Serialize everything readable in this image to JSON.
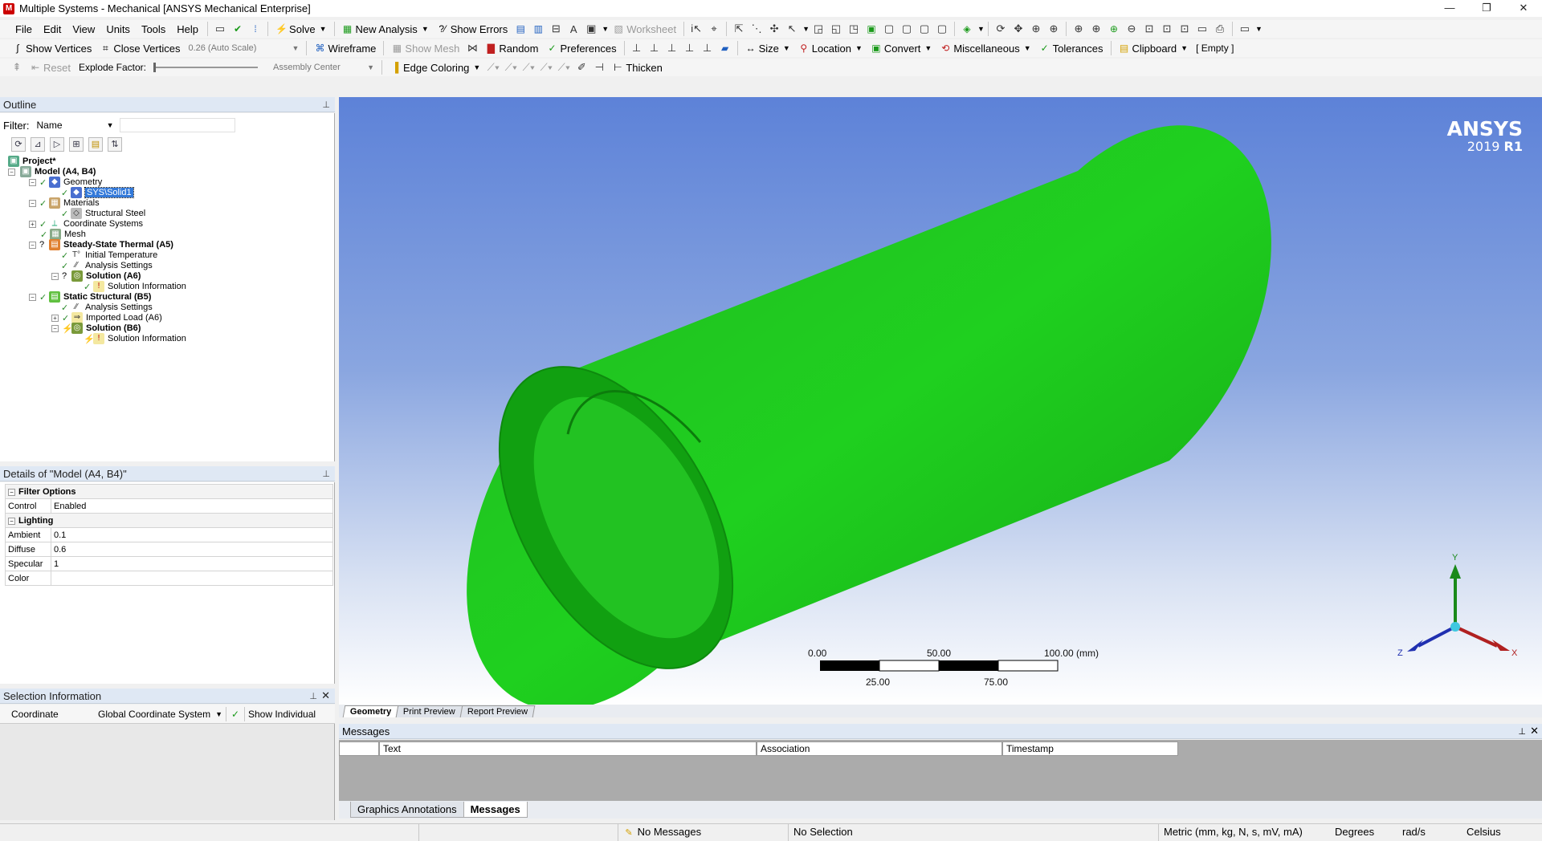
{
  "window": {
    "title": "Multiple Systems - Mechanical [ANSYS Mechanical Enterprise]",
    "app_icon": "M"
  },
  "menu": [
    "File",
    "Edit",
    "View",
    "Units",
    "Tools",
    "Help"
  ],
  "toolbar1": {
    "solve": "Solve",
    "new_analysis": "New Analysis",
    "show_errors": "Show Errors",
    "worksheet": "Worksheet"
  },
  "toolbar2": {
    "show_vertices": "Show Vertices",
    "close_vertices": "Close Vertices",
    "scale": "0.26 (Auto Scale)",
    "wireframe": "Wireframe",
    "show_mesh": "Show Mesh",
    "random": "Random",
    "preferences": "Preferences",
    "size": "Size",
    "location": "Location",
    "convert": "Convert",
    "miscellaneous": "Miscellaneous",
    "tolerances": "Tolerances",
    "clipboard": "Clipboard",
    "clipboard_state": "[ Empty ]"
  },
  "toolbar3": {
    "reset": "Reset",
    "explode_factor": "Explode Factor:",
    "assembly_center": "Assembly Center",
    "edge_coloring": "Edge Coloring",
    "thicken": "Thicken"
  },
  "outline": {
    "title": "Outline",
    "filter_label": "Filter:",
    "filter_value": "Name",
    "tree": [
      {
        "label": "Project*",
        "bold": true
      },
      {
        "label": "Model (A4, B4)",
        "bold": true
      },
      {
        "label": "Geometry",
        "bold": false
      },
      {
        "label": "SYS\\Solid1",
        "bold": false,
        "selected": true
      },
      {
        "label": "Materials",
        "bold": false
      },
      {
        "label": "Structural Steel",
        "bold": false
      },
      {
        "label": "Coordinate Systems",
        "bold": false
      },
      {
        "label": "Mesh",
        "bold": false
      },
      {
        "label": "Steady-State Thermal (A5)",
        "bold": true
      },
      {
        "label": "Initial Temperature",
        "bold": false
      },
      {
        "label": "Analysis Settings",
        "bold": false
      },
      {
        "label": "Solution (A6)",
        "bold": true
      },
      {
        "label": "Solution Information",
        "bold": false
      },
      {
        "label": "Static Structural (B5)",
        "bold": true
      },
      {
        "label": "Analysis Settings",
        "bold": false
      },
      {
        "label": "Imported Load (A6)",
        "bold": false
      },
      {
        "label": "Solution (B6)",
        "bold": true
      },
      {
        "label": "Solution Information",
        "bold": false
      }
    ]
  },
  "details": {
    "title": "Details of \"Model (A4, B4)\"",
    "groups": [
      {
        "name": "Filter Options",
        "rows": [
          {
            "key": "Control",
            "value": "Enabled"
          }
        ]
      },
      {
        "name": "Lighting",
        "rows": [
          {
            "key": "Ambient",
            "value": "0.1"
          },
          {
            "key": "Diffuse",
            "value": "0.6"
          },
          {
            "key": "Specular",
            "value": "1"
          },
          {
            "key": "Color",
            "value": ""
          }
        ]
      }
    ]
  },
  "selection_info": {
    "title": "Selection Information",
    "coordinate_label": "Coordinate",
    "coordinate_system": "Global Coordinate System",
    "show_individual": "Show Individual"
  },
  "viewport": {
    "logo": "ANSYS",
    "version_year": "2019",
    "version_release": "R1",
    "scale_bar": {
      "top_labels": [
        "0.00",
        "50.00",
        "100.00 (mm)"
      ],
      "bottom_labels": [
        "25.00",
        "75.00"
      ]
    },
    "triad": {
      "x": "X",
      "y": "Y",
      "z": "Z"
    },
    "body_color": "#00c000",
    "tabs": [
      "Geometry",
      "Print Preview",
      "Report Preview"
    ]
  },
  "messages": {
    "title": "Messages",
    "columns": [
      "",
      "Text",
      "Association",
      "Timestamp"
    ],
    "tabs": [
      "Graphics Annotations",
      "Messages"
    ]
  },
  "status": {
    "messages": "No Messages",
    "selection": "No Selection",
    "units": "Metric (mm, kg, N, s, mV, mA)",
    "angle": "Degrees",
    "angular_velocity": "rad/s",
    "temperature": "Celsius"
  }
}
